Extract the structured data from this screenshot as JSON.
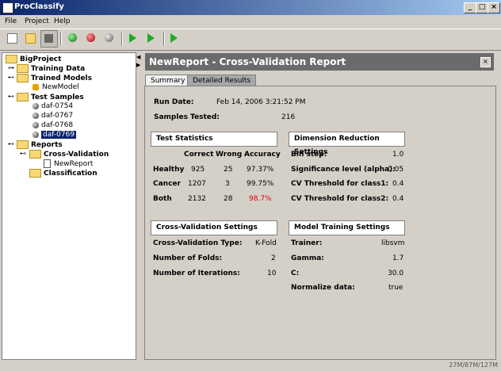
{
  "app": {
    "title": "ProClassify"
  },
  "menu": [
    "File",
    "Project",
    "Help"
  ],
  "tree": {
    "root": "BigProject",
    "training_data": "Training Data",
    "trained_models": "Trained Models",
    "new_model": "NewModel",
    "test_samples": "Test Samples",
    "samples": [
      "daf-0754",
      "daf-0767",
      "daf-0768",
      "daf-0769"
    ],
    "reports": "Reports",
    "cross_validation": "Cross-Validation",
    "new_report": "NewReport",
    "classification": "Classification"
  },
  "report": {
    "title": "NewReport -  Cross-Validation Report",
    "tabs": [
      "Summary",
      "Detailed Results"
    ],
    "run_date_label": "Run Date:",
    "run_date": "Feb 14, 2006 3:21:52 PM",
    "samples_label": "Samples Tested:",
    "samples_value": "216",
    "test_statistics": {
      "heading": "Test Statistics",
      "columns": [
        "Correct",
        "Wrong",
        "Accuracy"
      ],
      "rows": [
        {
          "label": "Healthy",
          "correct": "925",
          "wrong": "25",
          "accuracy": "97.37%"
        },
        {
          "label": "Cancer",
          "correct": "1207",
          "wrong": "3",
          "accuracy": "99.75%"
        },
        {
          "label": "Both",
          "correct": "2132",
          "wrong": "28",
          "accuracy": "98.7%"
        }
      ]
    },
    "dimension_reduction": {
      "heading": "Dimension Reduction Settings",
      "rows": [
        {
          "label": "Bin step:",
          "value": "1.0"
        },
        {
          "label": "Significance level (alpha):",
          "value": "0.05"
        },
        {
          "label": "CV Threshold for class1:",
          "value": "0.4"
        },
        {
          "label": "CV Threshold for class2:",
          "value": "0.4"
        }
      ]
    },
    "cv_settings": {
      "heading": "Cross-Validation Settings",
      "rows": [
        {
          "label": "Cross-Validation Type:",
          "value": "K-Fold"
        },
        {
          "label": "Number of Folds:",
          "value": "2"
        },
        {
          "label": "Number of Iterations:",
          "value": "10"
        }
      ]
    },
    "model_training": {
      "heading": "Model Training Settings",
      "rows": [
        {
          "label": "Trainer:",
          "value": "libsvm"
        },
        {
          "label": "Gamma:",
          "value": "1.7"
        },
        {
          "label": "C:",
          "value": "30.0"
        },
        {
          "label": "Normalize data:",
          "value": "true"
        }
      ]
    }
  },
  "status": {
    "memory": "27M/87M/127M"
  },
  "colors": {
    "accent": "#0a246a",
    "highlight_red": "#e00000",
    "header_gray": "#6b6b6b"
  }
}
